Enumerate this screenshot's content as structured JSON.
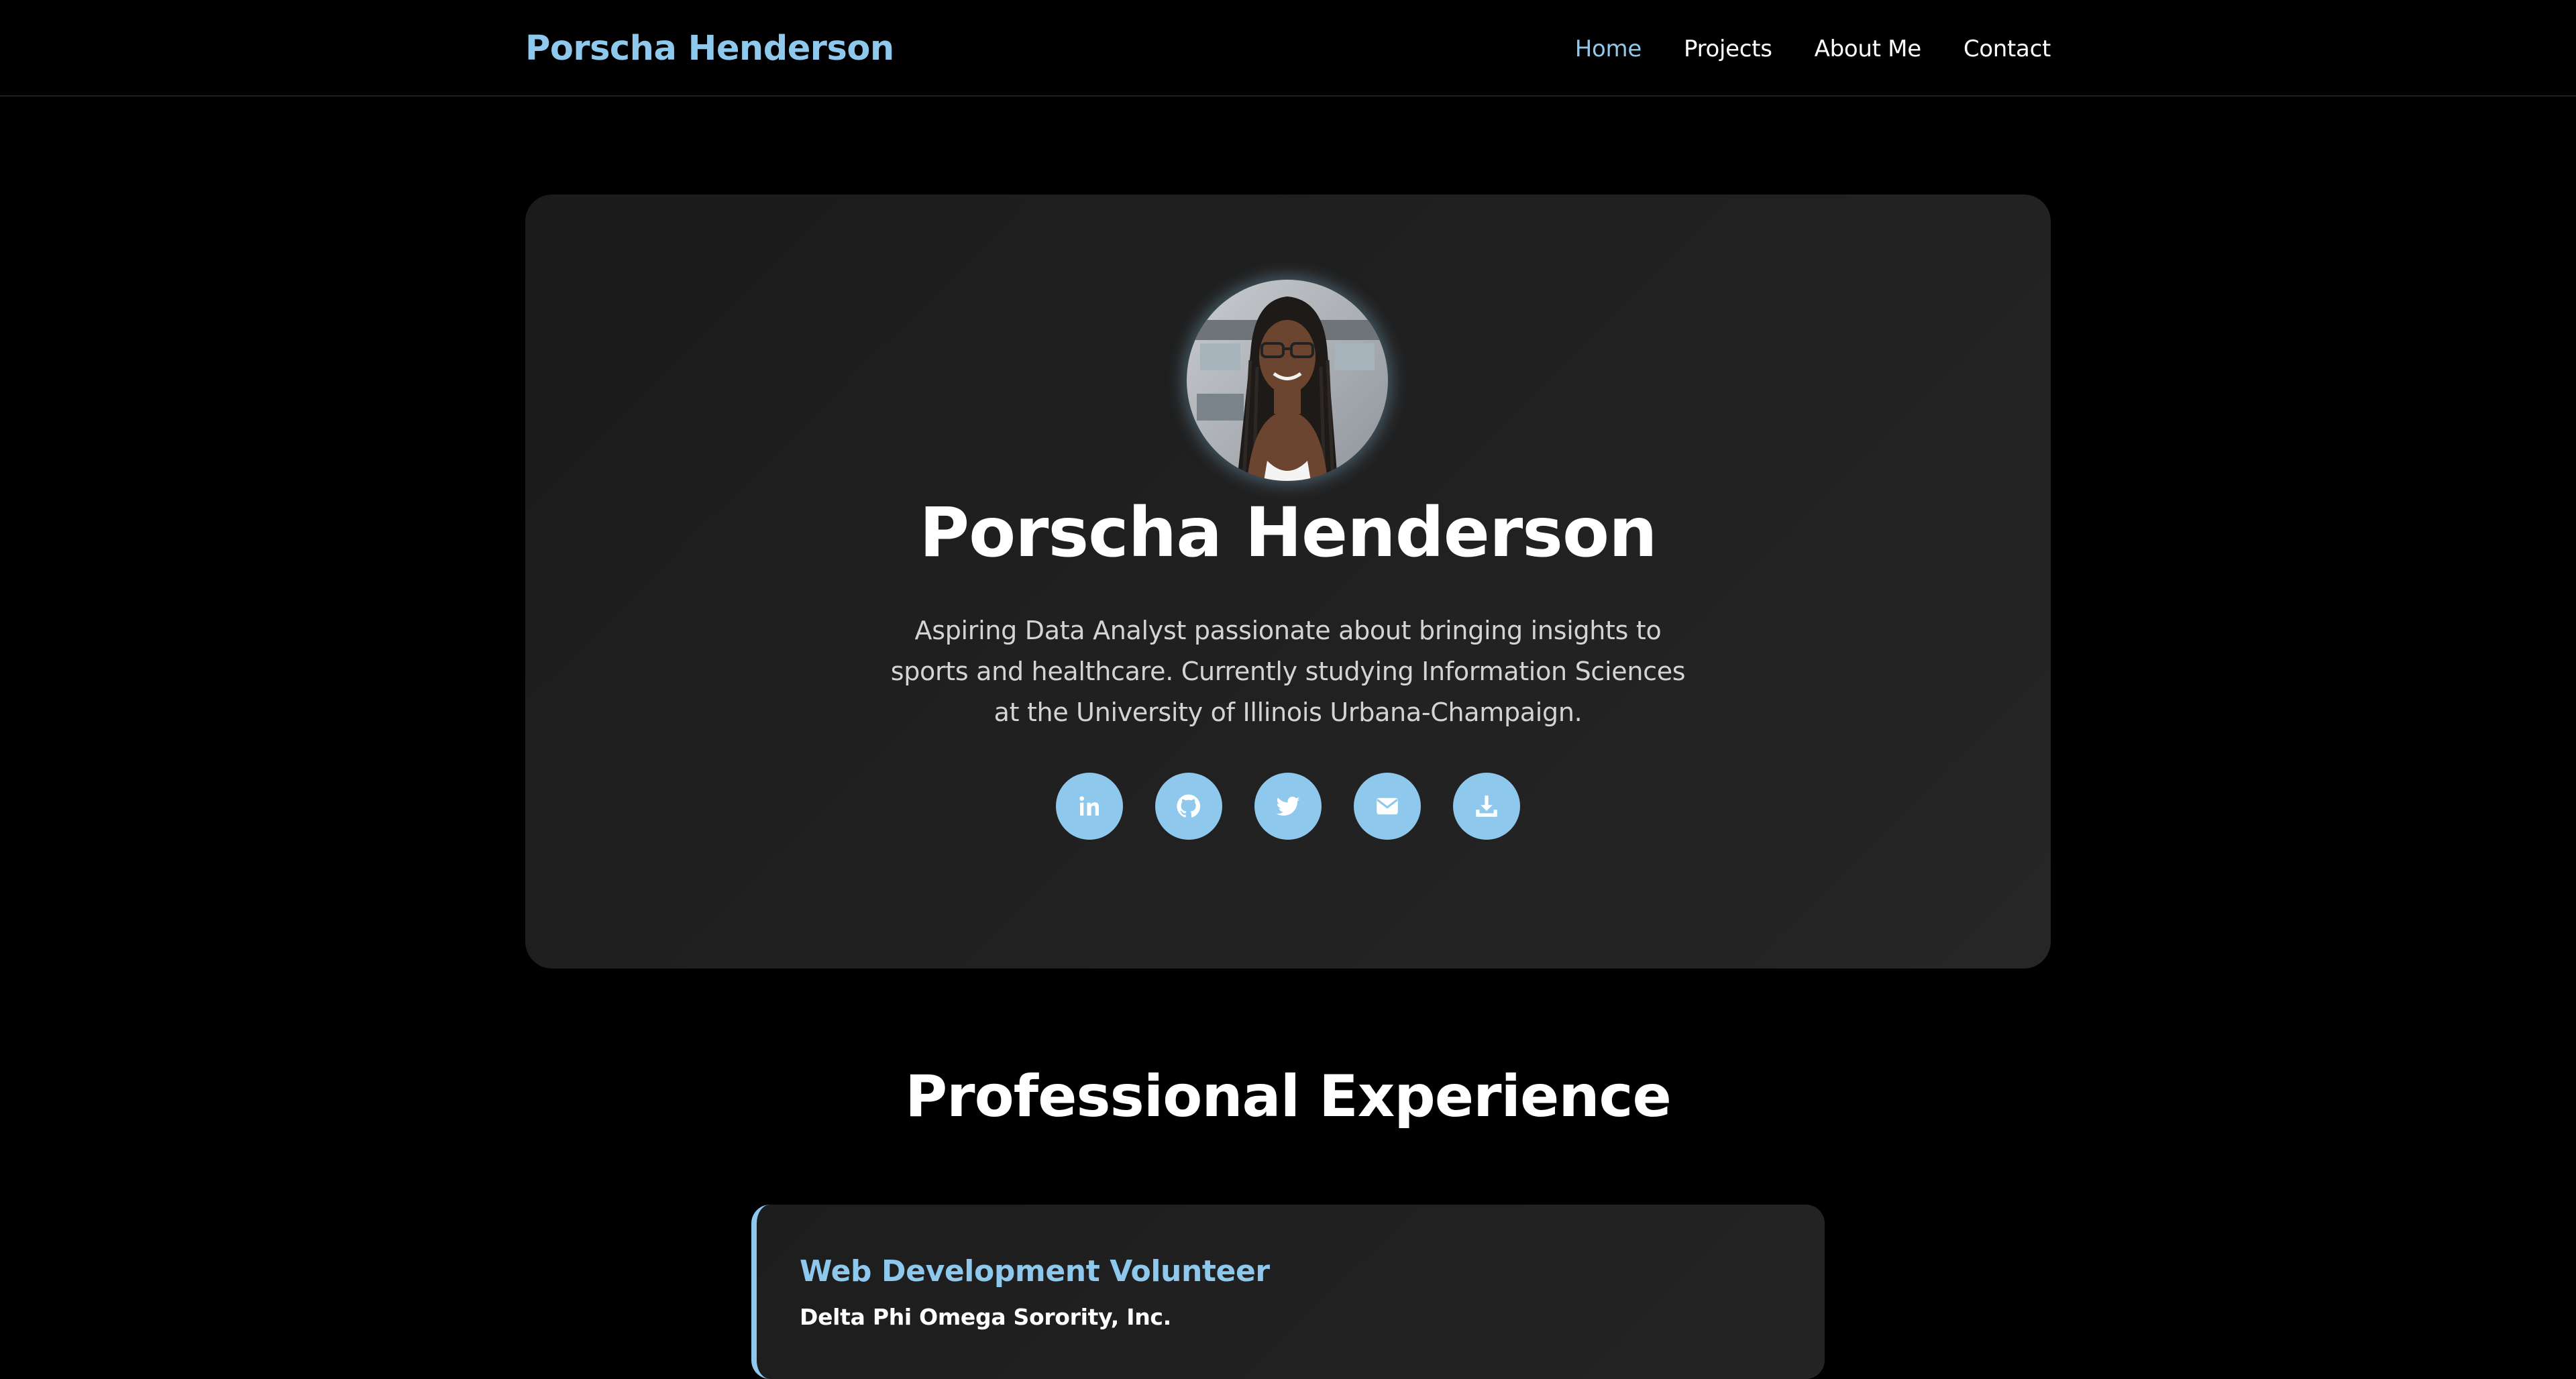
{
  "brand": {
    "name": "Porscha Henderson"
  },
  "nav": {
    "items": [
      {
        "label": "Home",
        "active": true
      },
      {
        "label": "Projects",
        "active": false
      },
      {
        "label": "About Me",
        "active": false
      },
      {
        "label": "Contact",
        "active": false
      }
    ]
  },
  "hero": {
    "name": "Porscha Henderson",
    "bio": "Aspiring Data Analyst passionate about bringing insights to sports and healthcare. Currently studying Information Sciences at the University of Illinois Urbana-Champaign.",
    "socials": [
      {
        "icon": "linkedin-icon"
      },
      {
        "icon": "github-icon"
      },
      {
        "icon": "twitter-icon"
      },
      {
        "icon": "email-icon"
      },
      {
        "icon": "download-icon"
      }
    ]
  },
  "experience": {
    "title": "Professional Experience",
    "items": [
      {
        "role": "Web Development Volunteer",
        "org": "Delta Phi Omega Sorority, Inc."
      }
    ]
  },
  "colors": {
    "accent": "#8ec8ec",
    "background": "#000000",
    "card": "#1f1f1f"
  }
}
